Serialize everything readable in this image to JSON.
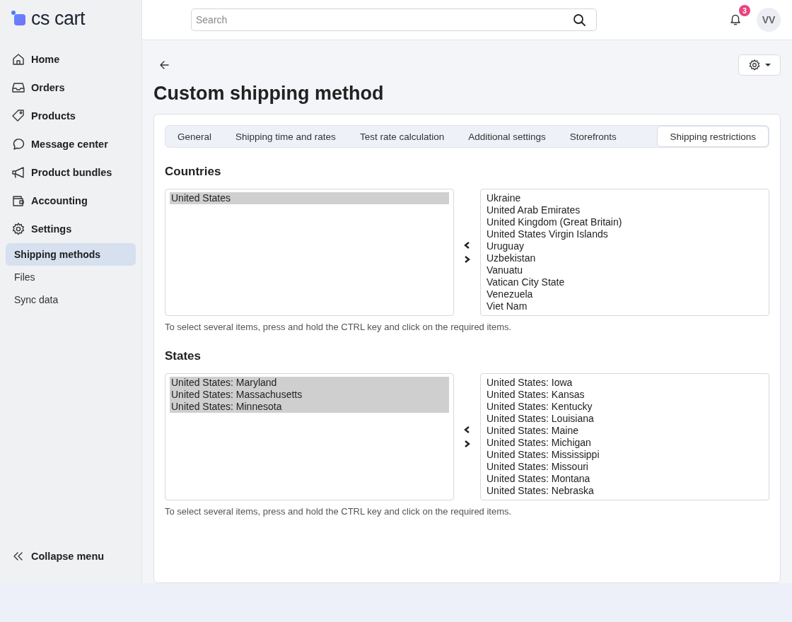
{
  "logo": {
    "text": "cs cart"
  },
  "sidebar": {
    "items": [
      {
        "label": "Home",
        "kind": "main",
        "selected": false
      },
      {
        "label": "Orders",
        "kind": "main",
        "selected": false
      },
      {
        "label": "Products",
        "kind": "main",
        "selected": false
      },
      {
        "label": "Message center",
        "kind": "main",
        "selected": false
      },
      {
        "label": "Product bundles",
        "kind": "main",
        "selected": false
      },
      {
        "label": "Accounting",
        "kind": "main",
        "selected": false
      },
      {
        "label": "Settings",
        "kind": "main",
        "selected": false
      },
      {
        "label": "Shipping methods",
        "kind": "sub",
        "selected": true
      },
      {
        "label": "Files",
        "kind": "sub",
        "selected": false
      },
      {
        "label": "Sync data",
        "kind": "sub",
        "selected": false
      }
    ],
    "collapse": "Collapse menu"
  },
  "header": {
    "search": {
      "placeholder": "Search"
    },
    "notifications": "3",
    "avatar": "VV"
  },
  "page": {
    "title": "Custom shipping method",
    "tabs": [
      {
        "label": "General",
        "selected": false
      },
      {
        "label": "Shipping time and rates",
        "selected": false
      },
      {
        "label": "Test rate calculation",
        "selected": false
      },
      {
        "label": "Additional settings",
        "selected": false
      },
      {
        "label": "Storefronts",
        "selected": false
      },
      {
        "label": "Shipping restrictions",
        "selected": true
      }
    ],
    "sections": [
      {
        "title": "Countries",
        "selected_items": [
          {
            "label": "United States",
            "selected": true
          }
        ],
        "available_items": [
          {
            "label": "Ukraine",
            "selected": false
          },
          {
            "label": "United Arab Emirates",
            "selected": false
          },
          {
            "label": "United Kingdom (Great Britain)",
            "selected": false
          },
          {
            "label": "United States Virgin Islands",
            "selected": false
          },
          {
            "label": "Uruguay",
            "selected": false
          },
          {
            "label": "Uzbekistan",
            "selected": false
          },
          {
            "label": "Vanuatu",
            "selected": false
          },
          {
            "label": "Vatican City State",
            "selected": false
          },
          {
            "label": "Venezuela",
            "selected": false
          },
          {
            "label": "Viet Nam",
            "selected": false
          }
        ],
        "hint": "To select several items, press and hold the CTRL key and click on the required items."
      },
      {
        "title": "States",
        "selected_items": [
          {
            "label": "United States: Maryland",
            "selected": true
          },
          {
            "label": "United States: Massachusetts",
            "selected": true
          },
          {
            "label": "United States: Minnesota",
            "selected": true
          }
        ],
        "available_items": [
          {
            "label": "United States: Iowa",
            "selected": false
          },
          {
            "label": "United States: Kansas",
            "selected": false
          },
          {
            "label": "United States: Kentucky",
            "selected": false
          },
          {
            "label": "United States: Louisiana",
            "selected": false
          },
          {
            "label": "United States: Maine",
            "selected": false
          },
          {
            "label": "United States: Michigan",
            "selected": false
          },
          {
            "label": "United States: Mississippi",
            "selected": false
          },
          {
            "label": "United States: Missouri",
            "selected": false
          },
          {
            "label": "United States: Montana",
            "selected": false
          },
          {
            "label": "United States: Nebraska",
            "selected": false
          }
        ],
        "hint": "To select several items, press and hold the CTRL key and click on the required items."
      }
    ]
  }
}
